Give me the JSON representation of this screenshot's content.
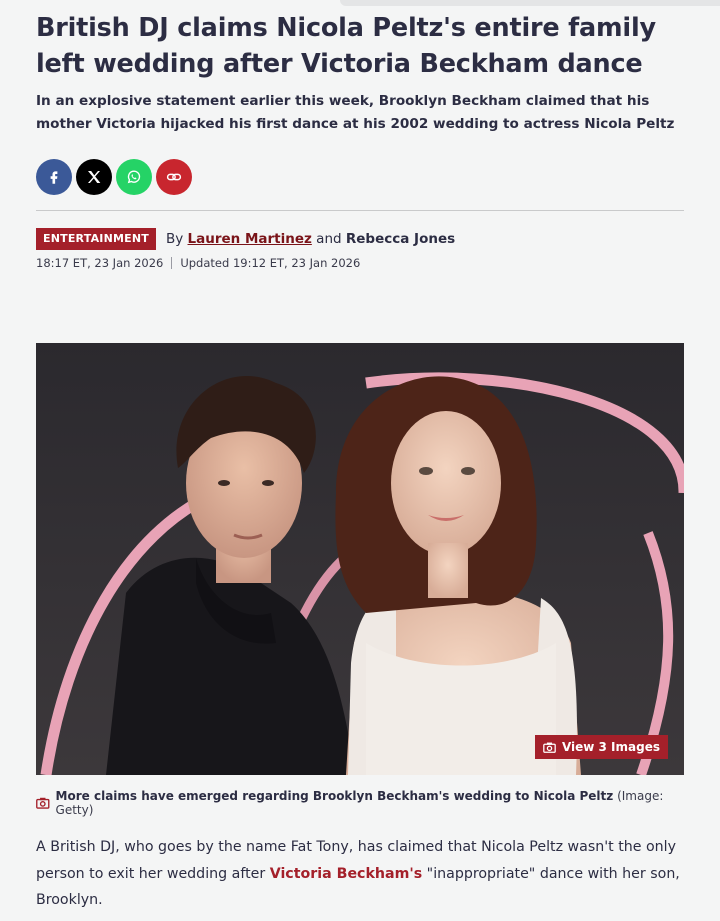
{
  "article": {
    "headline": "British DJ claims Nicola Peltz's entire family left wedding after Victoria Beckham dance",
    "standfirst": "In an explosive statement earlier this week, Brooklyn Beckham claimed that his mother Victoria hijacked his first dance at his 2002 wedding to actress Nicola Peltz",
    "category": "ENTERTAINMENT",
    "byline_prefix": "By",
    "author1": "Lauren Martinez",
    "byline_and": "and",
    "author2": "Rebecca Jones",
    "published": "18:17 ET, 23 Jan 2026",
    "updated": "Updated 19:12 ET, 23 Jan 2026"
  },
  "share": {
    "facebook_color": "#3b5998",
    "x_color": "#000000",
    "whatsapp_color": "#25d366",
    "link_color": "#c8262e"
  },
  "image": {
    "view_label": "View 3 Images",
    "caption": "More claims have emerged regarding Brooklyn Beckham's wedding to Nicola Peltz",
    "credit": "(Image: Getty)"
  },
  "body": {
    "p1_before": "A British DJ, who goes by the name Fat Tony, has claimed that Nicola Peltz wasn't the only person to exit her wedding after",
    "p1_link": "Victoria Beckham's",
    "p1_after": "\"inappropriate\" dance with her son, Brooklyn."
  },
  "colors": {
    "accent": "#a4202a",
    "heading": "#2c2d43"
  }
}
